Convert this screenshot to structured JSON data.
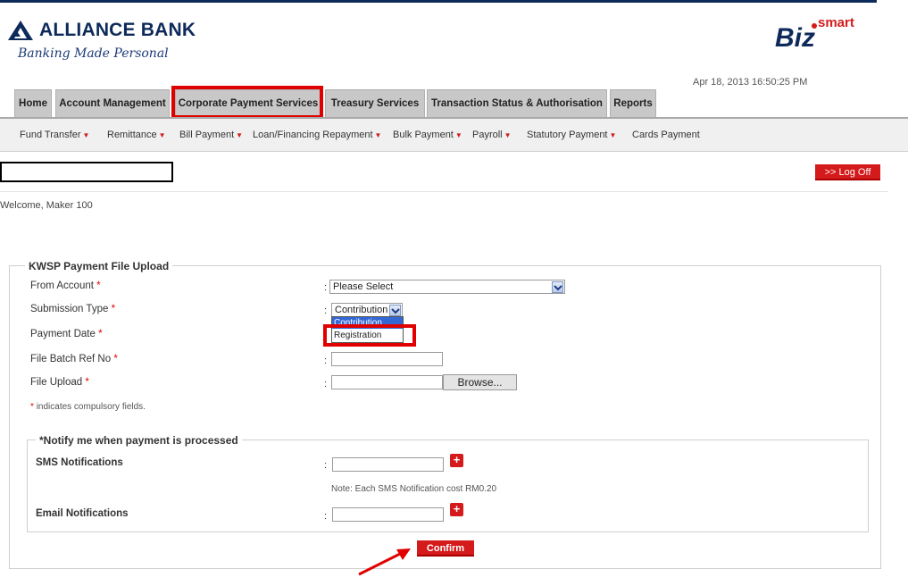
{
  "header": {
    "brand": "ALLIANCE BANK",
    "tagline": "Banking Made Personal",
    "biz_logo": "Biz",
    "biz_logo_sup": "smart",
    "datetime": "Apr 18, 2013 16:50:25 PM"
  },
  "main_tabs": [
    {
      "label": "Home"
    },
    {
      "label": "Account Management"
    },
    {
      "label": "Corporate Payment Services",
      "highlighted": true
    },
    {
      "label": "Treasury Services"
    },
    {
      "label": "Transaction Status & Authorisation"
    },
    {
      "label": "Reports"
    }
  ],
  "sub_nav": [
    {
      "label": "Fund Transfer",
      "dropdown": true
    },
    {
      "label": "Remittance",
      "dropdown": true
    },
    {
      "label": "Bill Payment",
      "dropdown": true
    },
    {
      "label": "Loan/Financing Repayment",
      "dropdown": true
    },
    {
      "label": "Bulk Payment",
      "dropdown": true
    },
    {
      "label": "Payroll",
      "dropdown": true
    },
    {
      "label": "Statutory Payment",
      "dropdown": true
    },
    {
      "label": "Cards Payment",
      "dropdown": false
    }
  ],
  "logoff_label": ">> Log Off",
  "welcome": "Welcome, Maker 100",
  "form": {
    "legend": "KWSP Payment File Upload",
    "from_account_label": "From Account",
    "from_account_value": "Please Select",
    "submission_type_label": "Submission Type",
    "submission_type_value": "Contribution",
    "submission_type_options": [
      "Contribution",
      "Registration"
    ],
    "payment_date_label": "Payment Date",
    "file_batch_label": "File Batch Ref No",
    "file_upload_label": "File Upload",
    "browse_label": "Browse...",
    "required_marker": "*",
    "colon": ":",
    "compulsory_note": "indicates compulsory fields."
  },
  "notify": {
    "legend": "*Notify me when payment is processed",
    "sms_label": "SMS Notifications",
    "sms_note": "Note: Each SMS Notification cost RM0.20",
    "email_label": "Email Notifications",
    "add_symbol": "+"
  },
  "confirm_label": "Confirm",
  "colors": {
    "brand_navy": "#0d2a5a",
    "accent_red": "#d41a1a",
    "highlight_red": "#e00000",
    "tab_gray": "#c8c8c8",
    "dropdown_selected": "#3367d6"
  }
}
